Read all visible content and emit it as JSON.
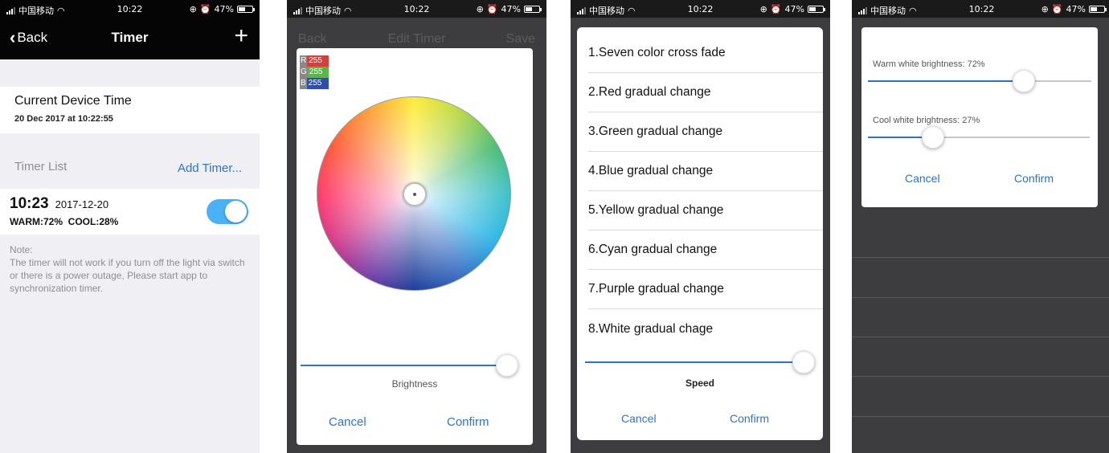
{
  "status_bar": {
    "carrier": "中国移动",
    "time": "10:22",
    "battery": "47%"
  },
  "screen1": {
    "nav": {
      "back_label": "Back",
      "title": "Timer",
      "add_icon": "plus-icon"
    },
    "current_time": {
      "label": "Current Device Time",
      "value": "20 Dec 2017 at 10:22:55"
    },
    "timer_list": {
      "label": "Timer List",
      "add_label": "Add Timer..."
    },
    "timer": {
      "time": "10:23",
      "date": "2017-12-20",
      "detail": "WARM:72%  COOL:28%",
      "enabled": true
    },
    "note": "Note:\nThe timer will not work if you turn off the light via switch or there is a power outage, Please start app to synchronization timer."
  },
  "screen2": {
    "nav": {
      "back_label": "Back",
      "title": "Edit Timer",
      "save_label": "Save"
    },
    "rgb": {
      "r_label": "R",
      "r_value": "255",
      "g_label": "G",
      "g_value": "255",
      "b_label": "B",
      "b_value": "255"
    },
    "brightness": {
      "label": "Brightness",
      "value": 1.0
    },
    "buttons": {
      "cancel": "Cancel",
      "confirm": "Confirm"
    }
  },
  "screen3": {
    "modes": [
      "1.Seven color cross fade",
      "2.Red gradual change",
      "3.Green gradual change",
      "4.Blue gradual change",
      "5.Yellow gradual change",
      "6.Cyan gradual change",
      "7.Purple gradual change",
      "8.White gradual chage"
    ],
    "speed": {
      "label": "Speed",
      "value": 1.0
    },
    "buttons": {
      "cancel": "Cancel",
      "confirm": "Confirm"
    }
  },
  "screen4": {
    "warm": {
      "label": "Warm white brightness: 72%",
      "value": 0.72
    },
    "cool": {
      "label": "Cool white brightness: 27%",
      "value": 0.27
    },
    "buttons": {
      "cancel": "Cancel",
      "confirm": "Confirm"
    }
  },
  "colors": {
    "accent": "#2d73c9",
    "switch_on": "#4bb1f5",
    "nav_bg": "#050505",
    "dim_bg": "#3d3d3f"
  }
}
